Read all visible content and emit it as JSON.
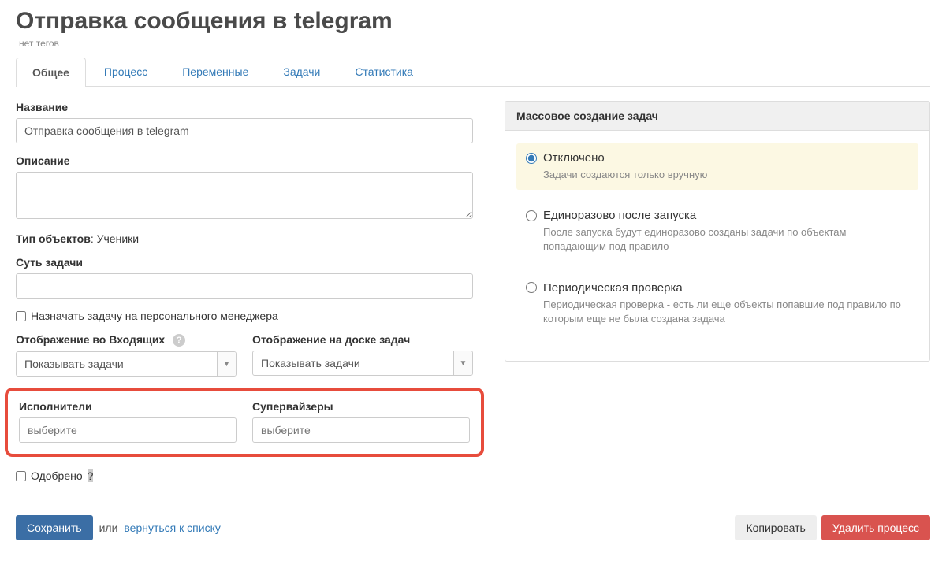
{
  "header": {
    "title": "Отправка сообщения в telegram",
    "no_tags": "нет тегов"
  },
  "tabs": [
    "Общее",
    "Процесс",
    "Переменные",
    "Задачи",
    "Статистика"
  ],
  "active_tab": 0,
  "form": {
    "name_label": "Название",
    "name_value": "Отправка сообщения в telegram",
    "desc_label": "Описание",
    "desc_value": "",
    "type_label": "Тип объектов",
    "type_value": "Ученики",
    "essence_label": "Суть задачи",
    "essence_value": "",
    "assign_personal_label": "Назначать задачу на персонального менеджера",
    "inbox_label": "Отображение во Входящих",
    "inbox_value": "Показывать задачи",
    "board_label": "Отображение на доске задач",
    "board_value": "Показывать задачи",
    "performers_label": "Исполнители",
    "performers_placeholder": "выберите",
    "supervisors_label": "Супервайзеры",
    "supervisors_placeholder": "выберите",
    "approved_label": "Одобрено"
  },
  "footer": {
    "save": "Сохранить",
    "or": "или",
    "back": "вернуться к списку",
    "copy": "Копировать",
    "delete": "Удалить процесс"
  },
  "mass": {
    "header": "Массовое создание задач",
    "options": [
      {
        "title": "Отключено",
        "desc": "Задачи создаются только вручную"
      },
      {
        "title": "Единоразово после запуска",
        "desc": "После запуска будут единоразово созданы задачи по объектам попадающим под правило"
      },
      {
        "title": "Периодическая проверка",
        "desc": "Периодическая проверка - есть ли еще объекты попавшие под правило по которым еще не была создана задача"
      }
    ],
    "selected": 0
  }
}
